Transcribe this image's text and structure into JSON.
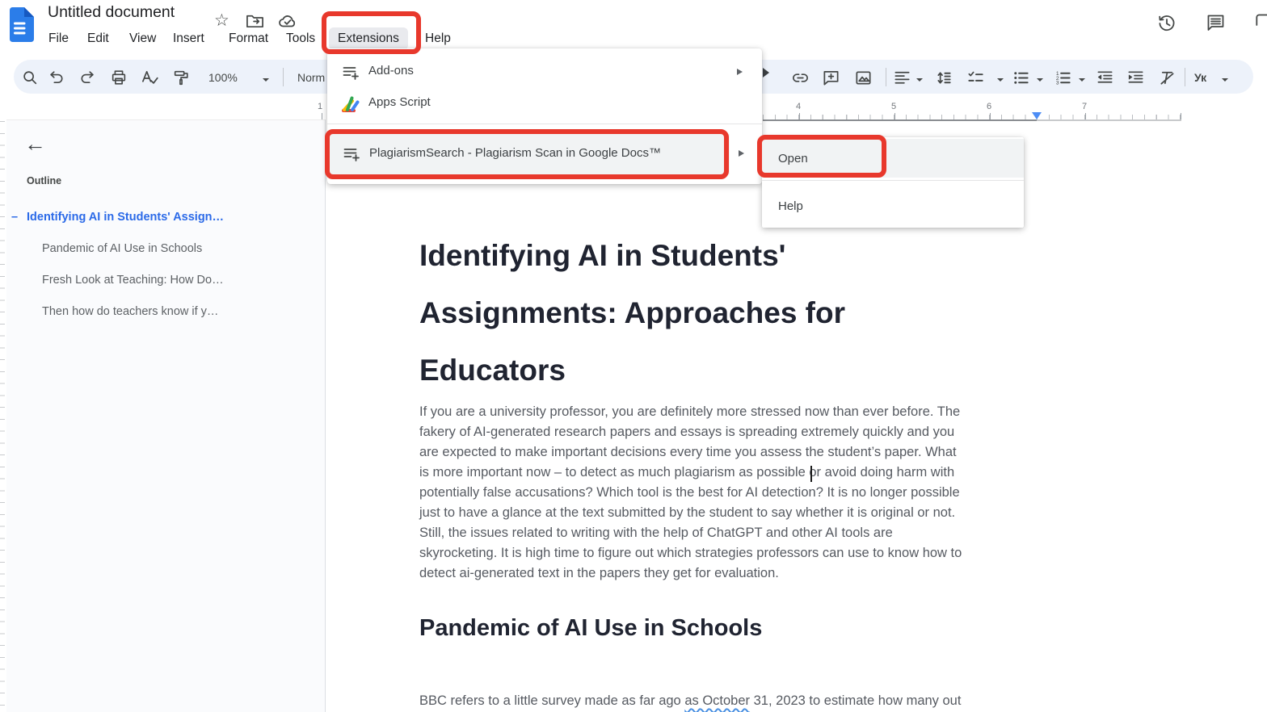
{
  "colors": {
    "annotation_red": "#e8382c",
    "docs_blue": "#2b7de9",
    "outline_active_blue": "#2b6ae8",
    "squiggle_blue": "#4a90e2",
    "ruler_marker_blue": "#4d8df5",
    "toolbar_bg": "#edf2fa"
  },
  "topbar": {
    "title": "Untitled document",
    "menu": [
      "File",
      "Edit",
      "View",
      "Insert",
      "Format",
      "Tools",
      "Extensions",
      "Help"
    ]
  },
  "toolbar": {
    "zoom_value": "100%",
    "style_value": "Norm",
    "input_tools_value": "Ук"
  },
  "ruler": {
    "labels": [
      "1",
      "4",
      "5",
      "6",
      "7"
    ]
  },
  "extensions_menu": {
    "items": [
      {
        "label": "Add-ons"
      },
      {
        "label": "Apps Script"
      },
      {
        "label": "PlagiarismSearch - Plagiarism Scan in Google Docs™"
      }
    ]
  },
  "plagiarism_submenu": {
    "items": [
      {
        "label": "Open"
      },
      {
        "label": "Help"
      }
    ]
  },
  "outline_panel": {
    "title": "Outline",
    "active_marker": "–",
    "back_arrow": "←",
    "items": [
      {
        "label": "Identifying AI in Students' Assign…"
      },
      {
        "label": "Pandemic of AI Use in Schools"
      },
      {
        "label": "Fresh Look at Teaching: How Do…"
      },
      {
        "label": "Then how do teachers know if y…"
      }
    ]
  },
  "document": {
    "heading1": "Identifying AI in Students'\nAssignments: Approaches for\nEducators",
    "paragraph1": "If you are a university professor, you are definitely more stressed now than ever before. The\nfakery of AI-generated research papers and essays is spreading extremely quickly and you\nare expected to make important decisions every time you assess the student’s paper. What\nis more important now – to detect as much plagiarism as possible or avoid doing harm with\npotentially false accusations? Which tool is the best for AI detection? It is no longer possible\njust to have a glance at the text submitted by the student to say whether it is original or not.\nStill, the issues related to writing with the help of ChatGPT and other AI tools are\nskyrocketing. It is high time to figure out which strategies professors can use to know how to\ndetect ai-generated text in the papers they get for evaluation.",
    "heading2": "Pandemic of AI Use in Schools",
    "last_line_before": "BBC refers to a little survey made as far ago ",
    "last_line_underlined": "as October",
    "last_line_after": " 31, 2023 to estimate how many out"
  }
}
